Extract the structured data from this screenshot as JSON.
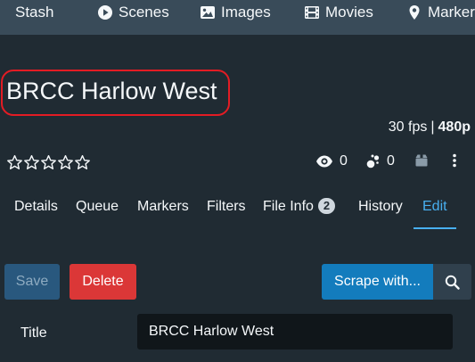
{
  "navbar": {
    "brand": "Stash",
    "items": [
      {
        "label": "Scenes",
        "icon": "play-circle-icon"
      },
      {
        "label": "Images",
        "icon": "image-icon"
      },
      {
        "label": "Movies",
        "icon": "film-icon"
      },
      {
        "label": "Markers",
        "icon": "map-marker-icon"
      }
    ]
  },
  "scene": {
    "title": "BRCC Harlow West",
    "fps": "30 fps",
    "separator": "|",
    "resolution": "480p",
    "rating": 0,
    "rating_max": 5
  },
  "toolbar": {
    "views_count": "0",
    "o_count": "0"
  },
  "tabs": [
    {
      "label": "Details"
    },
    {
      "label": "Queue"
    },
    {
      "label": "Markers"
    },
    {
      "label": "Filters"
    },
    {
      "label": "File Info",
      "badge": "2"
    },
    {
      "label": "History"
    },
    {
      "label": "Edit",
      "active": true
    }
  ],
  "edit": {
    "save_label": "Save",
    "delete_label": "Delete",
    "scrape_label": "Scrape with...",
    "title_label": "Title",
    "title_value": "BRCC Harlow West"
  },
  "colors": {
    "navbar": "#394b59",
    "background": "#202b33",
    "accent": "#48aff0",
    "danger": "#db3737",
    "primary": "#137cbd",
    "highlight_ring": "#e31c24"
  }
}
